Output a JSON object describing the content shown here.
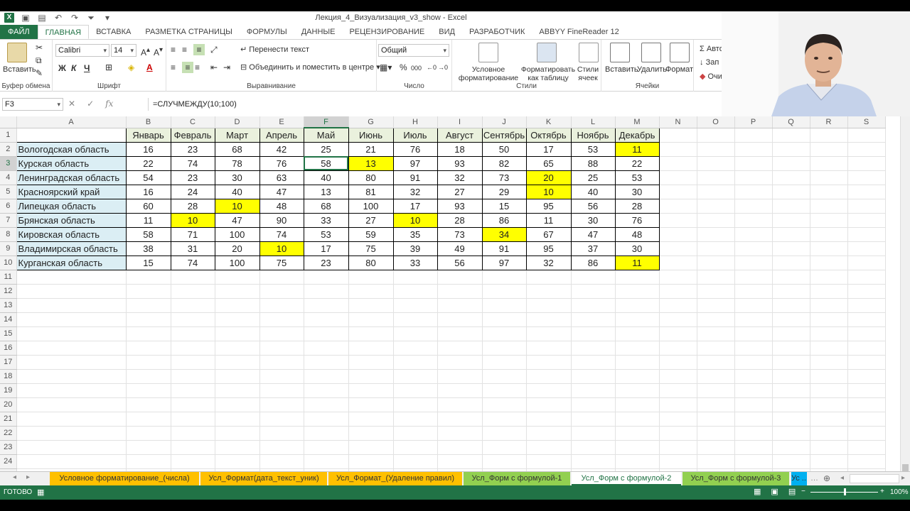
{
  "window": {
    "title": "Лекция_4_Визуализация_v3_show - Excel"
  },
  "ribbon_tabs": [
    "ФАЙЛ",
    "ГЛАВНАЯ",
    "ВСТАВКА",
    "РАЗМЕТКА СТРАНИЦЫ",
    "ФОРМУЛЫ",
    "ДАННЫЕ",
    "РЕЦЕНЗИРОВАНИЕ",
    "ВИД",
    "РАЗРАБОТЧИК",
    "ABBYY FineReader 12"
  ],
  "ribbon": {
    "clipboard": {
      "paste": "Вставить",
      "label": "Буфер обмена"
    },
    "font": {
      "name": "Calibri",
      "size": "14",
      "bold": "Ж",
      "italic": "К",
      "underline": "Ч",
      "label": "Шрифт"
    },
    "alignment": {
      "wrap": "Перенести текст",
      "merge": "Объединить и поместить в центре",
      "label": "Выравнивание"
    },
    "number": {
      "format": "Общий",
      "percent": "%",
      "thousands": "000",
      "label": "Число"
    },
    "styles": {
      "conditional": "Условное форматирование",
      "format_table": "Форматировать как таблицу",
      "cell_styles": "Стили ячеек",
      "label": "Стили"
    },
    "cells": {
      "insert": "Вставить",
      "delete": "Удалить",
      "format": "Формат",
      "label": "Ячейки"
    },
    "editing": {
      "autosum": "Авто",
      "fill": "Зап",
      "clear": "Очи"
    }
  },
  "formula_bar": {
    "name_box": "F3",
    "formula": "=СЛУЧМЕЖДУ(10;100)"
  },
  "columns": [
    "A",
    "B",
    "C",
    "D",
    "E",
    "F",
    "G",
    "H",
    "I",
    "J",
    "K",
    "L",
    "M",
    "N",
    "O",
    "P",
    "Q",
    "R",
    "S"
  ],
  "selected_column": "F",
  "selected_row": 3,
  "months": [
    "Январь",
    "Февраль",
    "Март",
    "Апрель",
    "Май",
    "Июнь",
    "Июль",
    "Август",
    "Сентябрь",
    "Октябрь",
    "Ноябрь",
    "Декабрь"
  ],
  "rows": [
    {
      "region": "Вологодская область",
      "values": [
        16,
        23,
        68,
        42,
        25,
        21,
        76,
        18,
        50,
        17,
        53,
        11
      ],
      "highlight": [
        11
      ]
    },
    {
      "region": "Курская область",
      "values": [
        22,
        74,
        78,
        76,
        58,
        13,
        97,
        93,
        82,
        65,
        88,
        22
      ],
      "highlight": [
        5
      ]
    },
    {
      "region": "Ленинградская область",
      "values": [
        54,
        23,
        30,
        63,
        40,
        80,
        91,
        32,
        73,
        20,
        25,
        53
      ],
      "highlight": [
        9
      ]
    },
    {
      "region": "Красноярский край",
      "values": [
        16,
        24,
        40,
        47,
        13,
        81,
        32,
        27,
        29,
        10,
        40,
        30
      ],
      "highlight": [
        9
      ]
    },
    {
      "region": "Липецкая область",
      "values": [
        60,
        28,
        10,
        48,
        68,
        100,
        17,
        93,
        15,
        95,
        56,
        28
      ],
      "highlight": [
        2
      ]
    },
    {
      "region": "Брянская область",
      "values": [
        11,
        10,
        47,
        90,
        33,
        27,
        10,
        28,
        86,
        11,
        30,
        76
      ],
      "highlight": [
        1,
        6
      ]
    },
    {
      "region": "Кировская область",
      "values": [
        58,
        71,
        100,
        74,
        53,
        59,
        35,
        73,
        34,
        67,
        47,
        48
      ],
      "highlight": [
        8
      ]
    },
    {
      "region": "Владимирская область",
      "values": [
        38,
        31,
        20,
        10,
        17,
        75,
        39,
        49,
        91,
        95,
        37,
        30
      ],
      "highlight": [
        3
      ]
    },
    {
      "region": "Курганская область",
      "values": [
        15,
        74,
        100,
        75,
        23,
        80,
        33,
        56,
        97,
        32,
        86,
        11
      ],
      "highlight": [
        11
      ]
    }
  ],
  "total_rows": 28,
  "sheet_tabs": [
    {
      "label": "Условное форматирование_(числа)",
      "color": "orange"
    },
    {
      "label": "Усл_Формат(дата_текст_уник)",
      "color": "orange"
    },
    {
      "label": "Усл_Формат_(Удаление правил)",
      "color": "orange"
    },
    {
      "label": "Усл_Форм с формулой-1",
      "color": "green"
    },
    {
      "label": "Усл_Форм с формулой-2",
      "color": "active"
    },
    {
      "label": "Усл_Форм с формулой-3",
      "color": "green"
    },
    {
      "label": "Ус ...",
      "color": "blue"
    }
  ],
  "status": {
    "ready": "ГОТОВО",
    "zoom": "100%"
  },
  "colors": {
    "excel_green": "#217346",
    "highlight_yellow": "#ffff00",
    "region_fill": "#dbeef4",
    "month_header_fill": "#eaf1dd",
    "tab_orange": "#ffc000",
    "tab_green": "#92d050",
    "tab_blue": "#00b0f0"
  }
}
